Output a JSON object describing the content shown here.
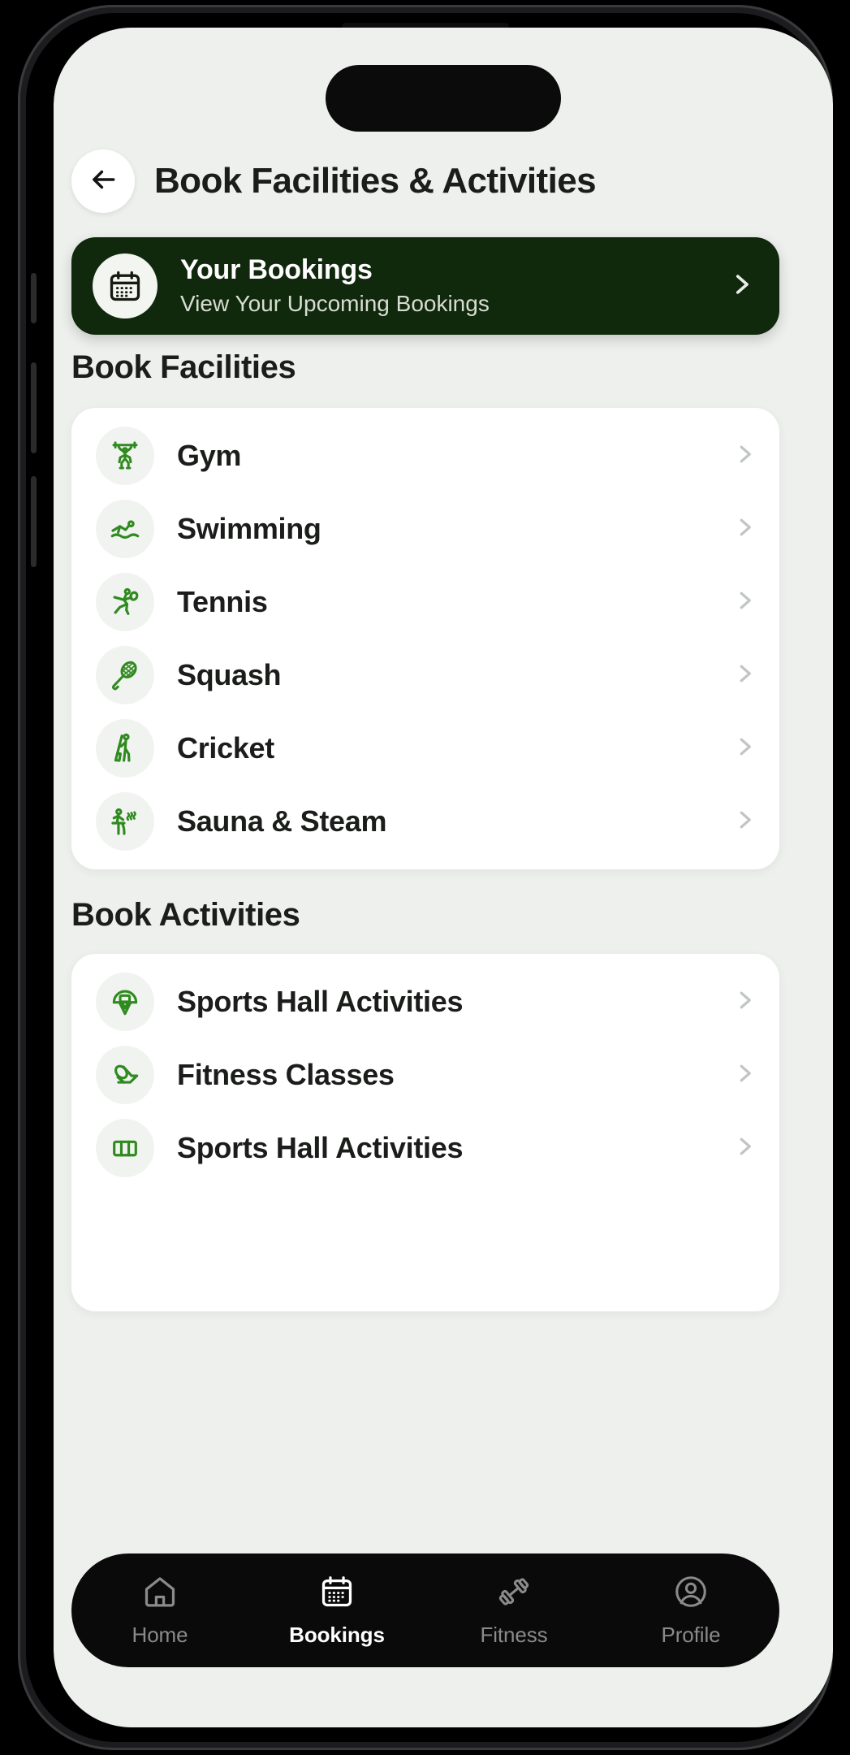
{
  "header": {
    "title": "Book Facilities & Activities",
    "back_icon": "arrow-left-icon"
  },
  "bookings_banner": {
    "title": "Your Bookings",
    "subtitle": "View Your Upcoming Bookings",
    "icon": "calendar-icon",
    "chevron_icon": "chevron-right-icon",
    "background_color": "#10280c"
  },
  "facilities_section": {
    "heading": "Book Facilities",
    "items": [
      {
        "label": "Gym",
        "icon": "weightlifter-icon"
      },
      {
        "label": "Swimming",
        "icon": "swimmer-icon"
      },
      {
        "label": "Tennis",
        "icon": "tennis-player-icon"
      },
      {
        "label": "Squash",
        "icon": "squash-racket-icon"
      },
      {
        "label": "Cricket",
        "icon": "cricket-batsman-icon"
      },
      {
        "label": "Sauna & Steam",
        "icon": "sauna-icon"
      }
    ]
  },
  "activities_section": {
    "heading": "Book Activities",
    "items": [
      {
        "label": "Sports Hall Activities",
        "icon": "basketball-hoop-icon"
      },
      {
        "label": "Fitness Classes",
        "icon": "yoga-mat-icon"
      },
      {
        "label": "Sports Hall Activities",
        "icon": "sports-hall-icon"
      }
    ]
  },
  "bottom_nav": {
    "items": [
      {
        "label": "Home",
        "icon": "home-icon",
        "active": false
      },
      {
        "label": "Bookings",
        "icon": "calendar-icon",
        "active": true
      },
      {
        "label": "Fitness",
        "icon": "dumbbell-icon",
        "active": false
      },
      {
        "label": "Profile",
        "icon": "user-icon",
        "active": false
      }
    ]
  },
  "theme": {
    "accent_green": "#2f8a1f",
    "dark_green": "#10280c",
    "page_background": "#eef0ee",
    "card_background": "#ffffff",
    "nav_background": "#0a0a0a"
  }
}
